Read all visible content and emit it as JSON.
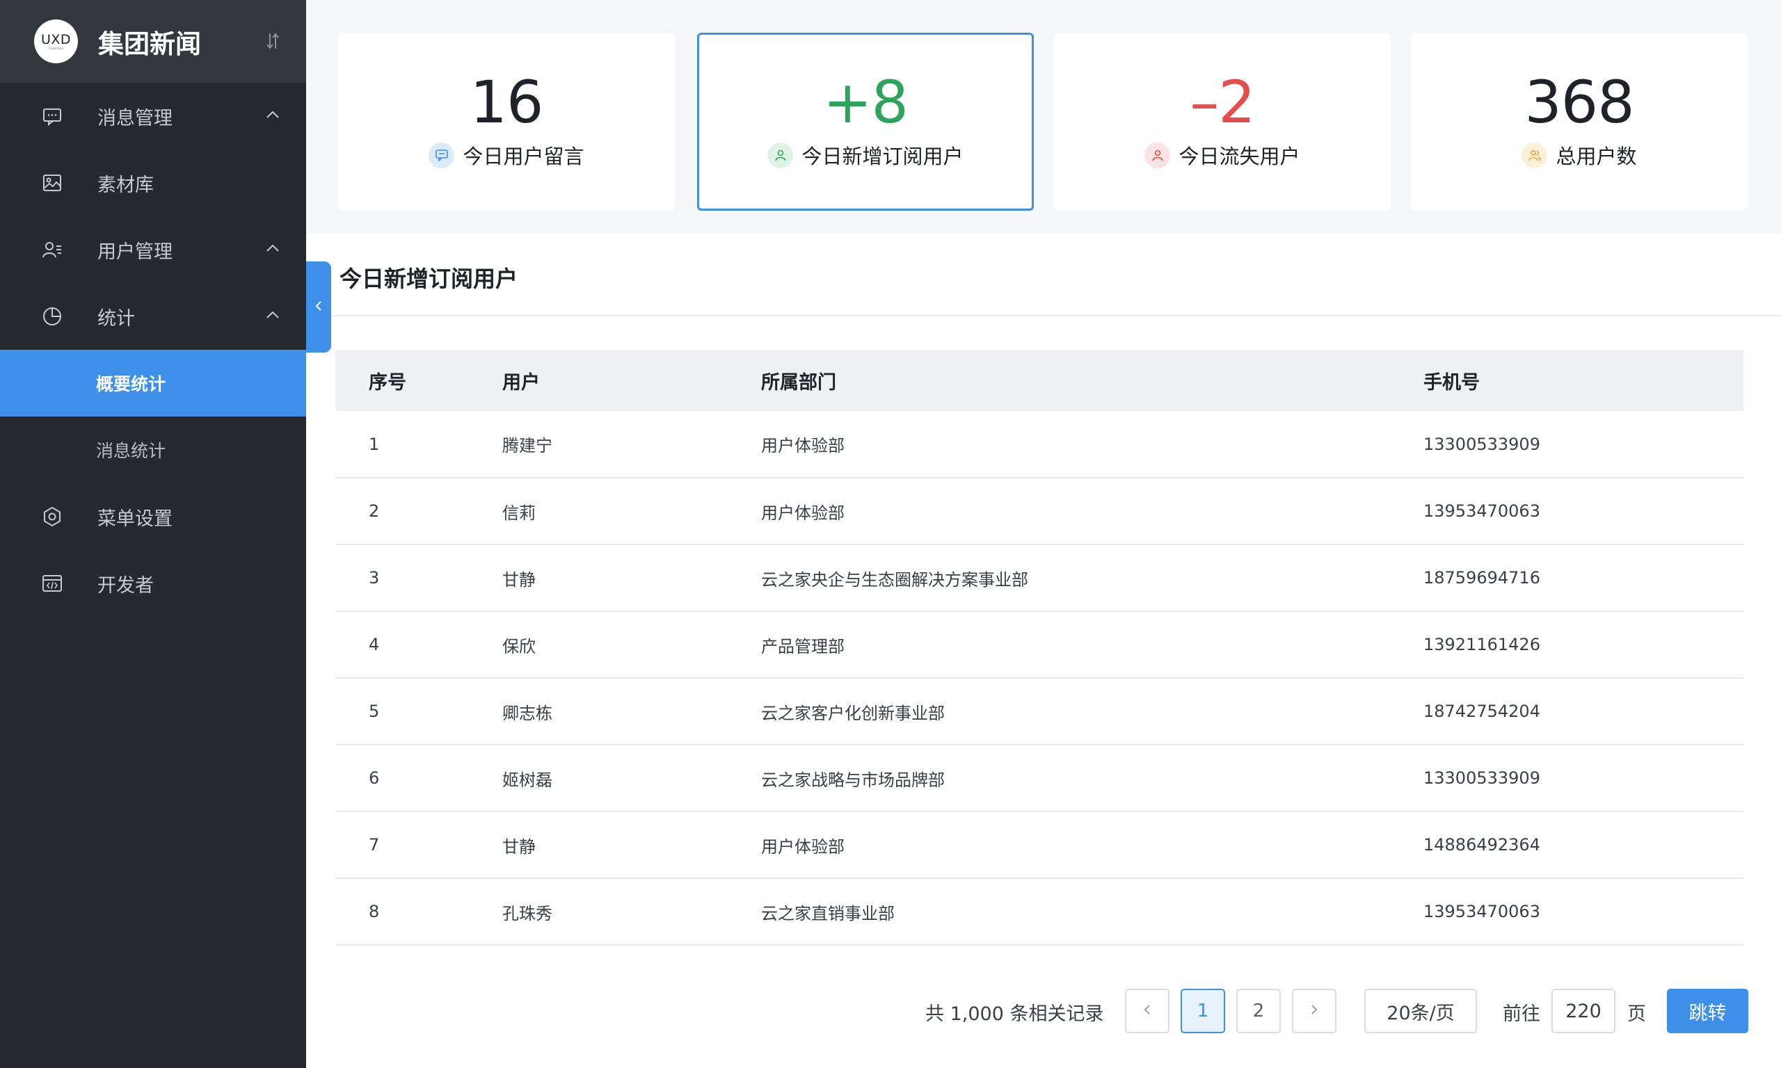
{
  "brand": {
    "logo_text": "UXD",
    "logo_sub": "Cloud Hub",
    "title": "集团新闻"
  },
  "sidebar": {
    "items": [
      {
        "label": "消息管理",
        "icon": "message-icon",
        "expandable": true
      },
      {
        "label": "素材库",
        "icon": "image-icon",
        "expandable": false
      },
      {
        "label": "用户管理",
        "icon": "users-icon",
        "expandable": true
      },
      {
        "label": "统计",
        "icon": "pie-chart-icon",
        "expandable": true
      },
      {
        "label": "菜单设置",
        "icon": "hexagon-settings-icon",
        "expandable": false
      },
      {
        "label": "开发者",
        "icon": "code-window-icon",
        "expandable": false
      }
    ],
    "submenu": [
      {
        "label": "概要统计",
        "active": true
      },
      {
        "label": "消息统计",
        "active": false
      }
    ]
  },
  "stats": [
    {
      "value": "16",
      "label": "今日用户留言",
      "color": "#1f2329",
      "icon": "chat-bubble-icon",
      "icon_bg": "#dcebfb",
      "icon_color": "#3d8fe8"
    },
    {
      "value": "+8",
      "label": "今日新增订阅用户",
      "color": "#2ea35b",
      "icon": "user-icon",
      "icon_bg": "#dff3e6",
      "icon_color": "#2ea35b"
    },
    {
      "value": "–2",
      "label": "今日流失用户",
      "color": "#e54c4c",
      "icon": "user-icon",
      "icon_bg": "#fbe3e3",
      "icon_color": "#e54c4c"
    },
    {
      "value": "368",
      "label": "总用户数",
      "color": "#1f2329",
      "icon": "users-icon",
      "icon_bg": "#fdf0d9",
      "icon_color": "#f0a23a"
    }
  ],
  "panel": {
    "title": "今日新增订阅用户"
  },
  "table": {
    "headers": [
      "序号",
      "用户",
      "所属部门",
      "手机号"
    ],
    "rows": [
      [
        "1",
        "腾建宁",
        "用户体验部",
        "13300533909"
      ],
      [
        "2",
        "信莉",
        "用户体验部",
        "13953470063"
      ],
      [
        "3",
        "甘静",
        "云之家央企与生态圈解决方案事业部",
        "18759694716"
      ],
      [
        "4",
        "保欣",
        "产品管理部",
        "13921161426"
      ],
      [
        "5",
        "卿志栋",
        "云之家客户化创新事业部",
        "18742754204"
      ],
      [
        "6",
        "姬树磊",
        "云之家战略与市场品牌部",
        "13300533909"
      ],
      [
        "7",
        "甘静",
        "用户体验部",
        "14886492364"
      ],
      [
        "8",
        "孔珠秀",
        "云之家直销事业部",
        "13953470063"
      ]
    ]
  },
  "pagination": {
    "total_text": "共 1,000 条相关记录",
    "pages": [
      "1",
      "2"
    ],
    "current_page": "1",
    "page_size": "20条/页",
    "goto_prefix": "前往",
    "goto_value": "220",
    "goto_suffix": "页",
    "goto_button": "跳转"
  },
  "colors": {
    "accent": "#3d8fe8",
    "sidebar_bg": "#26292e",
    "brand_bg": "#33373e"
  }
}
